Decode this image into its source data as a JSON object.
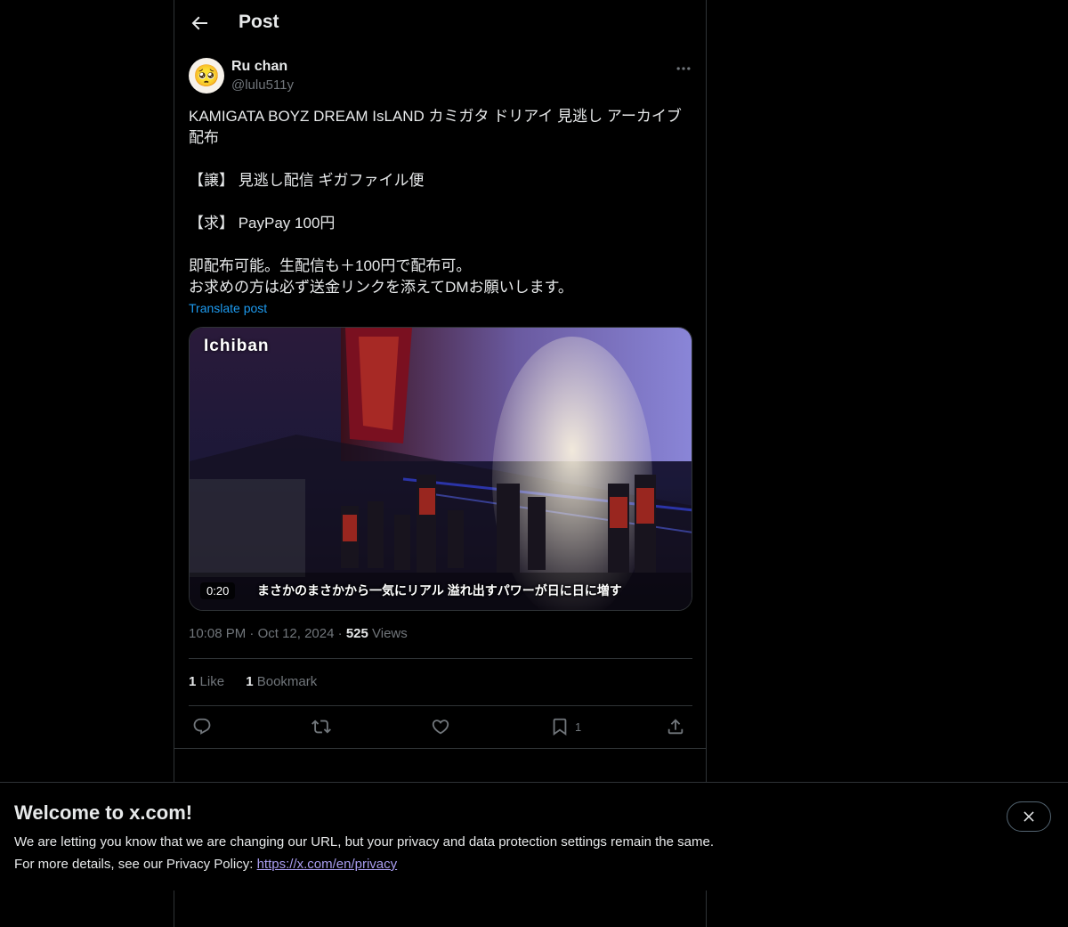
{
  "header": {
    "title": "Post"
  },
  "author": {
    "name": "Ru chan",
    "handle": "@lulu511y",
    "avatar_emoji": "🥺"
  },
  "post": {
    "text": "KAMIGATA BOYZ DREAM IsLAND カミガタ ドリアイ 見逃し アーカイブ 配布\n\n【譲】 見逃し配信 ギガファイル便\n\n【求】 PayPay 100円\n\n即配布可能。生配信も＋100円で配布可。\nお求めの方は必ず送金リンクを添えてDMお願いします。",
    "translate_label": "Translate post",
    "media": {
      "duration": "0:20",
      "brand_overlay": "Ichiban",
      "subtitle_overlay": "まさかのまさかから一気にリアル 溢れ出すパワーが日に日に増す"
    },
    "time": "10:08 PM",
    "date": "Oct 12, 2024",
    "views_count": "525",
    "views_label": "Views",
    "likes_count": "1",
    "likes_label": "Like",
    "bookmarks_count": "1",
    "bookmarks_label": "Bookmark",
    "bookmark_action_count": "1"
  },
  "banner": {
    "heading": "Welcome to x.com!",
    "line1": "We are letting you know that we are changing our URL, but your privacy and data protection settings remain the same.",
    "line2_prefix": "For more details, see our Privacy Policy: ",
    "link": "https://x.com/en/privacy"
  },
  "colors": {
    "accent": "#1d9bf0",
    "background": "#000000",
    "border": "#2f3336",
    "secondary_text": "#71767b"
  }
}
